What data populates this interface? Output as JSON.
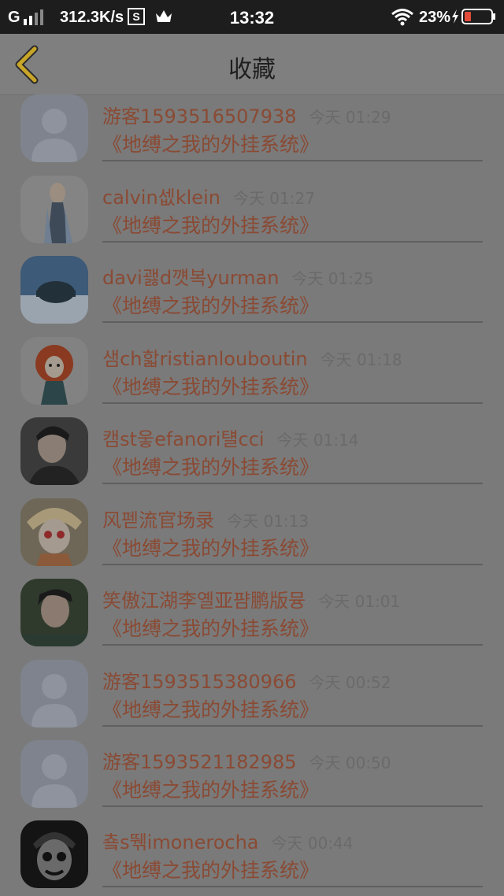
{
  "status_bar": {
    "network": "G",
    "speed": "312.3K/s",
    "time": "13:32",
    "battery": "23%",
    "icons": [
      "signal-icon",
      "s-app-icon",
      "crown-icon",
      "wifi-icon",
      "charging-icon",
      "battery-icon"
    ]
  },
  "header": {
    "title": "收藏",
    "back_icon": "chevron-left-icon",
    "accent_color": "#c8a528"
  },
  "favorites": [
    {
      "name": "游客1593516507938",
      "time": "今天 01:29",
      "book": "《地缚之我的外挂系统》",
      "avatar": "default-avatar-icon"
    },
    {
      "name": "calvin셊klein",
      "time": "今天 01:27",
      "book": "《地缚之我的外挂系统》",
      "avatar": "user-photo-man"
    },
    {
      "name": "davi괧d꺳복yurman",
      "time": "今天 01:25",
      "book": "《地缚之我的外挂系统》",
      "avatar": "user-photo-snow-trees"
    },
    {
      "name": "샘ch핣ristianlouboutin",
      "time": "今天 01:18",
      "book": "《地缚之我的外挂系统》",
      "avatar": "user-photo-redhead-cartoon"
    },
    {
      "name": "캠st웋efanori턜cci",
      "time": "今天 01:14",
      "book": "《地缚之我的外挂系统》",
      "avatar": "user-photo-boy"
    },
    {
      "name": "风펟流官场录",
      "time": "今天 01:13",
      "book": "《地缚之我的外挂系统》",
      "avatar": "user-photo-anime-girl"
    },
    {
      "name": "笑傲江湖李옐亚퍔鹏版뮹",
      "time": "今天 01:01",
      "book": "《地缚之我的外挂系统》",
      "avatar": "user-photo-young-man"
    },
    {
      "name": "游客1593515380966",
      "time": "今天 00:52",
      "book": "《地缚之我的外挂系统》",
      "avatar": "default-avatar-icon"
    },
    {
      "name": "游客1593521182985",
      "time": "今天 00:50",
      "book": "《地缚之我的外挂系统》",
      "avatar": "default-avatar-icon"
    },
    {
      "name": "춐s뛖imonerocha",
      "time": "今天 00:44",
      "book": "《地缚之我的外挂系统》",
      "avatar": "user-photo-clown"
    }
  ]
}
